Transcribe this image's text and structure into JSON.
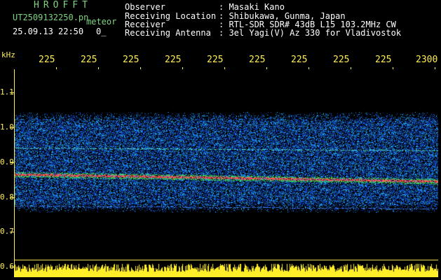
{
  "header": {
    "app_title": "HROFFT",
    "filename": "UT2509132250.pn",
    "mode": "meteor",
    "date": "25.09.13",
    "time": "22:50",
    "extra": "0_",
    "info": [
      {
        "label": "Observer",
        "value": ": Masaki Kano"
      },
      {
        "label": "Receiving Location",
        "value": ": Shibukawa, Gunma, Japan"
      },
      {
        "label": "Receiver",
        "value": ": RTL-SDR SDR# 43dB L15 103.2MHz CW"
      },
      {
        "label": "Receiving Antenna",
        "value": ": 3el Yagi(V) Az 330 for Vladivostok"
      }
    ]
  },
  "axes": {
    "y_unit": "kHz",
    "y_ticks": [
      "1.1",
      "1.0",
      "0.9",
      "0.8",
      "0.7",
      "0.6"
    ],
    "x_ticks": [
      "225",
      "225",
      "225",
      "225",
      "225",
      "225",
      "225",
      "225",
      "225",
      "2300"
    ]
  },
  "colors": {
    "axis": "#ffee55",
    "header_green": "#7fd47f",
    "header_white": "#ffffff",
    "signal_red": "#ff3b3b",
    "noise_blue": "#1f4fd8",
    "background": "#000000"
  }
}
